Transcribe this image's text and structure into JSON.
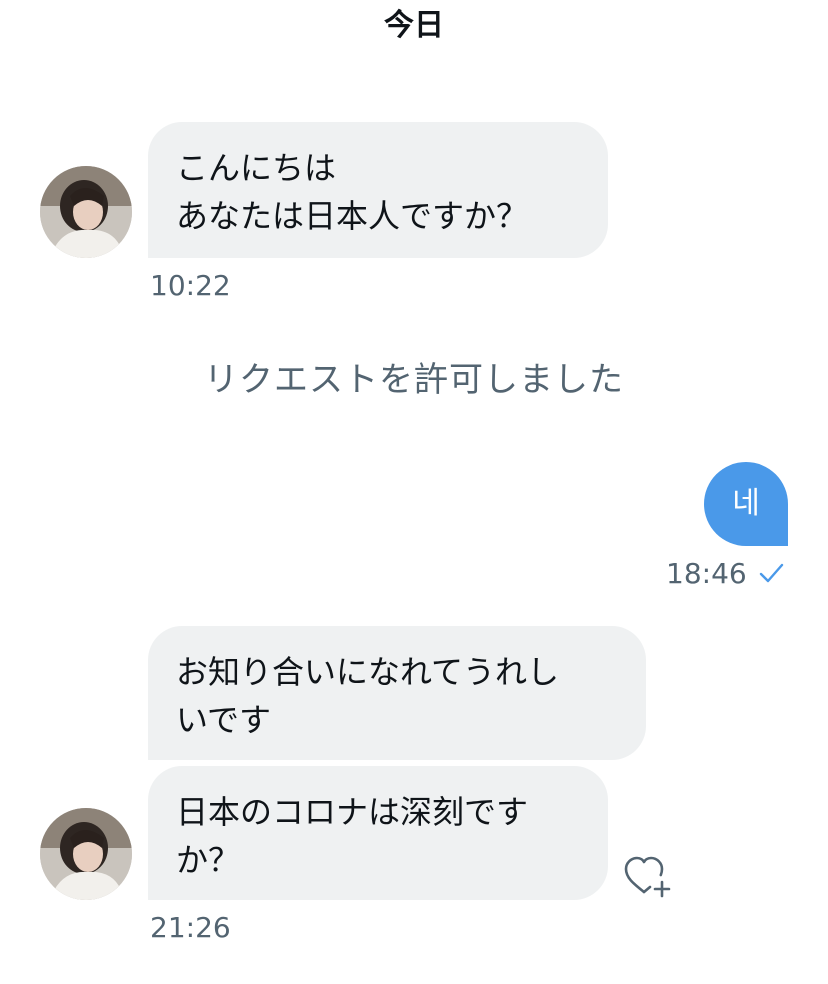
{
  "header": {
    "date_label": "今日"
  },
  "messages": {
    "first": {
      "text": "こんにちは\nあなたは日本人ですか？",
      "time": "10:22"
    },
    "system_note": "リクエストを許可しました",
    "reply": {
      "text": "네",
      "time": "18:46",
      "status_icon": "check-icon"
    },
    "second": {
      "text": "お知り合いになれてうれし\nいです",
      "time": "21:26"
    },
    "third": {
      "text": "日本のコロナは深刻です\nか？",
      "react_icon": "heart-plus-icon"
    }
  },
  "colors": {
    "incoming_bubble": "#eff1f2",
    "outgoing_bubble": "#4a99e9",
    "meta_text": "#536471",
    "check": "#4a99e9"
  }
}
